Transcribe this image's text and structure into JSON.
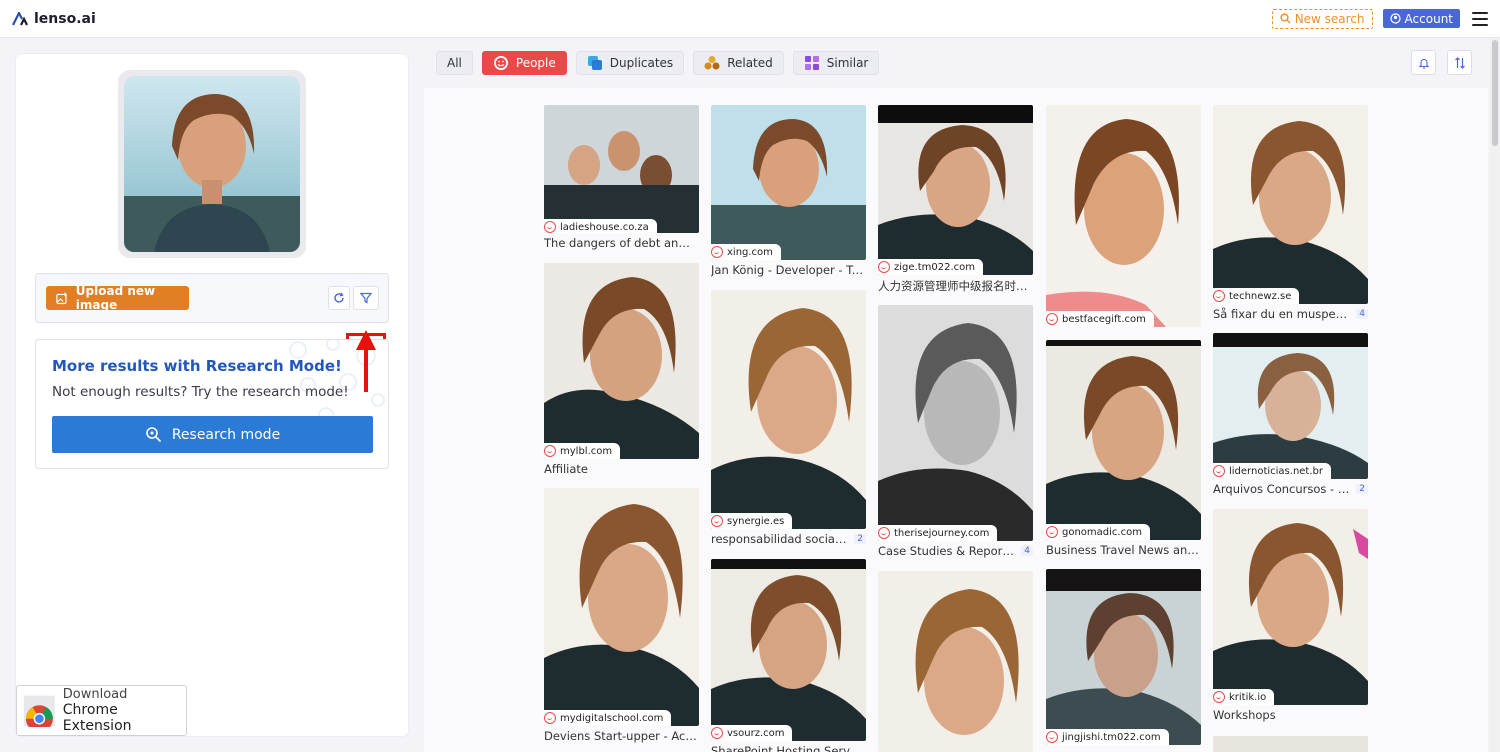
{
  "app": {
    "logo_text": "lenso.ai"
  },
  "topbar": {
    "new_search": "New search",
    "account": "Account"
  },
  "left": {
    "upload_label": "Upload new image",
    "research_title": "More results with Research Mode!",
    "research_sub": "Not enough results? Try the research mode!",
    "research_button": "Research mode",
    "extension_line1": "Download",
    "extension_line2": "Chrome Extension"
  },
  "chips": [
    {
      "label": "All",
      "active": false
    },
    {
      "label": "People",
      "active": true
    },
    {
      "label": "Duplicates",
      "active": false
    },
    {
      "label": "Related",
      "active": false
    },
    {
      "label": "Similar",
      "active": false
    }
  ],
  "results": [
    {
      "source": "ladieshouse.co.za",
      "title": "The dangers of debt and stra..."
    },
    {
      "source": "mylbl.com",
      "title": "Affiliate"
    },
    {
      "source": "mydigitalschool.com",
      "title": "Deviens Start-upper - Actuali..."
    },
    {
      "source": "xing.com",
      "title": "Jan König - Developer - Trici ..."
    },
    {
      "source": "synergie.es",
      "title": "responsabilidad social cor...",
      "badge": "2"
    },
    {
      "source": "vsourz.com",
      "title": "SharePoint Hosting Services"
    },
    {
      "source": "zige.tm022.com",
      "title": "人力资源管理师中级报名时间..."
    },
    {
      "source": "therisejourney.com",
      "title": "Case Studies & Reports | ...",
      "badge": "4"
    },
    {
      "source": "bestfacegift.com",
      "title": ""
    },
    {
      "source": "gonomadic.com",
      "title": "Business Travel News and U..."
    },
    {
      "source": "jingjishi.tm022.com",
      "title": ""
    },
    {
      "source": "technewz.se",
      "title": "Så fixar du en muspekare ...",
      "badge": "4"
    },
    {
      "source": "lidernoticias.net.br",
      "title": "Arquivos Concursos - Pági...",
      "badge": "2"
    },
    {
      "source": "kritik.io",
      "title": "Workshops"
    }
  ]
}
